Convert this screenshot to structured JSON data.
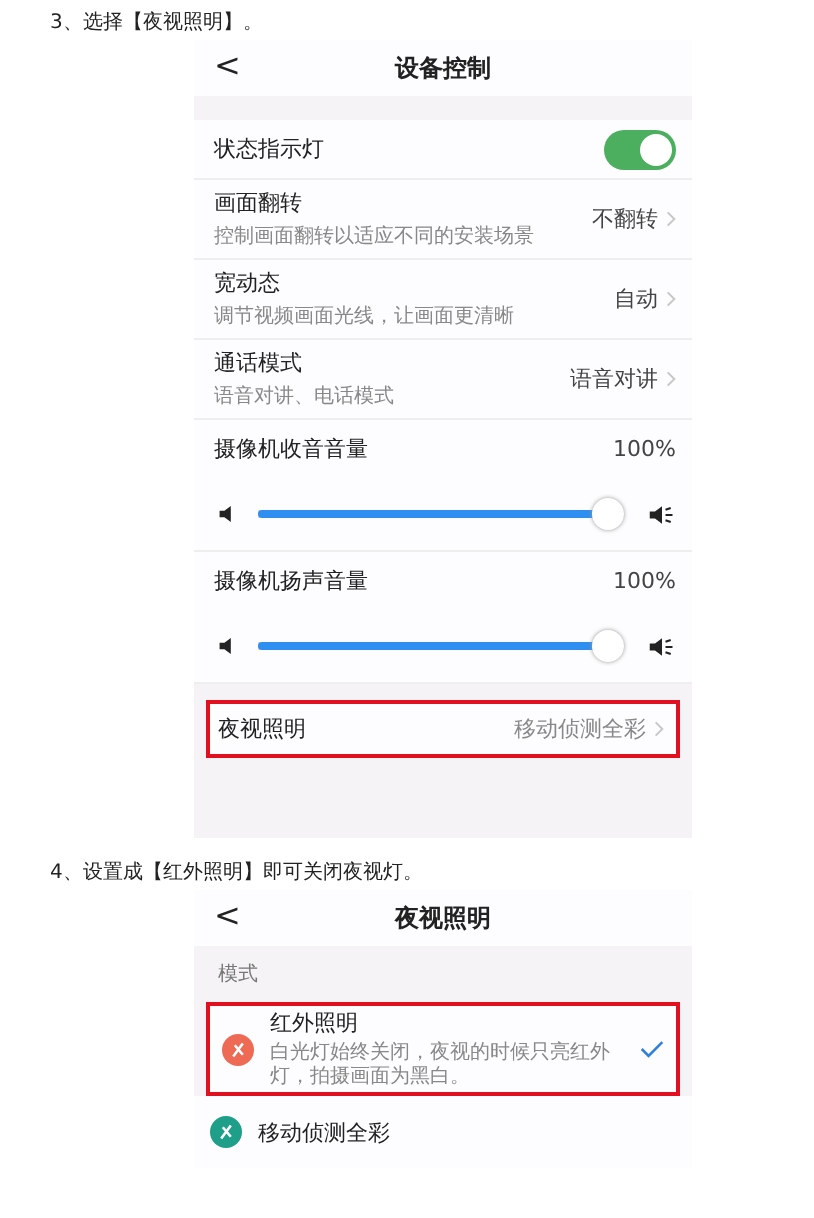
{
  "steps": [
    {
      "caption": "3、选择【夜视照明】。",
      "screen": {
        "title": "设备控制",
        "back": "<",
        "rows": [
          {
            "kind": "toggle",
            "label": "状态指示灯",
            "on": true
          },
          {
            "kind": "nav",
            "label": "画面翻转",
            "hint": "控制画面翻转以适应不同的安装场景",
            "value": "不翻转",
            "highlighted": false
          },
          {
            "kind": "nav",
            "label": "宽动态",
            "hint": "调节视频画面光线，让画面更清晰",
            "value": "自动",
            "highlighted": false
          },
          {
            "kind": "nav",
            "label": "通话模式",
            "hint": "语音对讲、电话模式",
            "value": "语音对讲",
            "highlighted": false
          },
          {
            "kind": "volume",
            "label": "摄像机收音音量",
            "reading": "100%",
            "level": 1
          },
          {
            "kind": "volume",
            "label": "摄像机扬声音量",
            "reading": "100%",
            "level": 1
          },
          {
            "kind": "nav",
            "label": "夜视照明",
            "value": "移动侦测全彩",
            "highlighted": true
          }
        ]
      }
    },
    {
      "caption": "4、设置成【红外照明】即可关闭夜视灯。",
      "screen": {
        "title": "夜视照明",
        "back": "<",
        "section": "模式",
        "options": [
          {
            "label": "红外照明",
            "hint": "白光灯始终关闭，夜视的时候只亮红外灯，拍摄画面为黑白。",
            "selected": true,
            "highlighted": true,
            "color": "#ee6a55"
          },
          {
            "label": "移动侦测全彩",
            "selected": false,
            "highlighted": false,
            "color": "#1f9e89"
          }
        ]
      }
    }
  ]
}
